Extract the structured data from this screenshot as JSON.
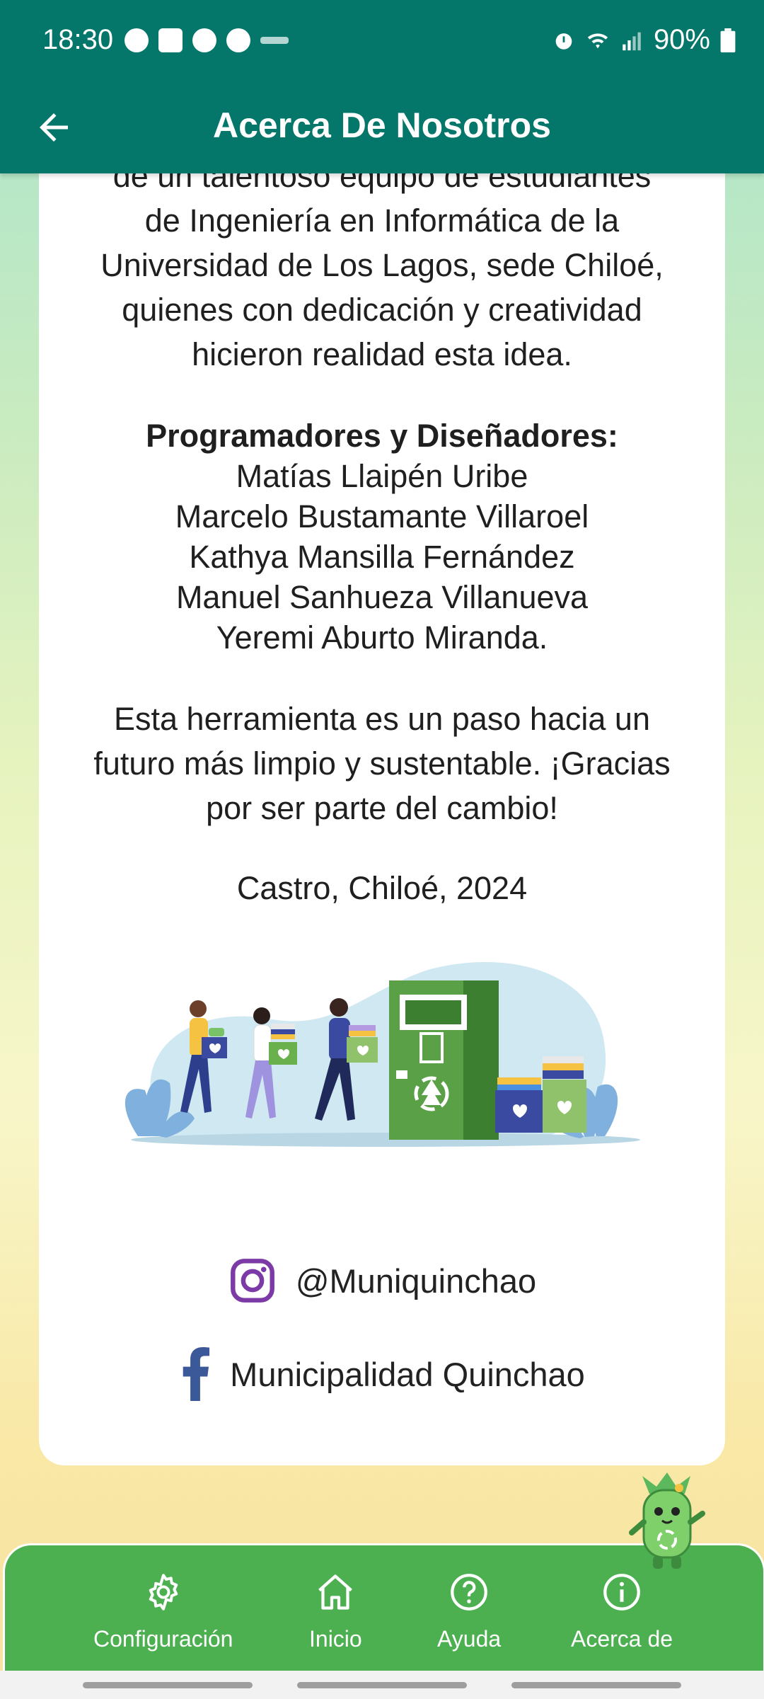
{
  "status_bar": {
    "time": "18:30",
    "battery": "90%"
  },
  "app_bar": {
    "title": "Acerca De Nosotros"
  },
  "about": {
    "intro_lines": [
      "de un talentoso equipo de estudiantes",
      "de Ingeniería en Informática de la",
      "Universidad de Los Lagos, sede Chiloé,",
      "quienes con dedicación y creatividad",
      "hicieron realidad esta idea."
    ],
    "team_heading": "Programadores y Diseñadores:",
    "team": [
      "Matías Llaipén Uribe",
      "Marcelo Bustamante Villaroel",
      "Kathya Mansilla Fernández",
      "Manuel Sanhueza Villanueva",
      "Yeremi Aburto Miranda."
    ],
    "closing_lines": [
      "Esta herramienta es un paso hacia un",
      "futuro más limpio y sustentable. ¡Gracias",
      "por ser parte del cambio!"
    ],
    "place_date": "Castro, Chiloé, 2024"
  },
  "social": {
    "instagram": {
      "handle": "@Muniquinchao",
      "icon": "instagram-icon",
      "color": "#7b3aa6"
    },
    "facebook": {
      "name": "Municipalidad Quinchao",
      "icon": "facebook-icon",
      "color": "#3b5998"
    }
  },
  "bottom_nav": {
    "items": [
      {
        "label": "Configuración",
        "icon": "gear-icon"
      },
      {
        "label": "Inicio",
        "icon": "home-icon"
      },
      {
        "label": "Ayuda",
        "icon": "help-icon"
      },
      {
        "label": "Acerca de",
        "icon": "info-icon"
      }
    ],
    "color": "#4caf50"
  },
  "colors": {
    "primary": "#05776a"
  }
}
